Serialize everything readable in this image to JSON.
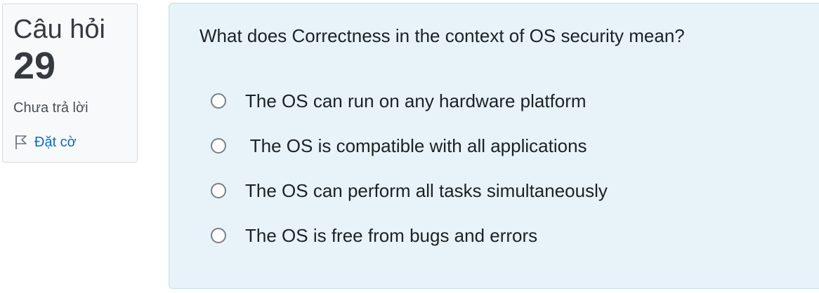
{
  "question_info": {
    "label": "Câu hỏi",
    "number": "29",
    "state": "Chưa trả lời",
    "flag_label": "Đặt cờ",
    "flag_icon": "flag-outline-icon"
  },
  "question": {
    "text": "What does Correctness in the context of OS security mean?",
    "answers": [
      {
        "label": "The OS can run on any hardware platform",
        "selected": false
      },
      {
        "label": " The OS is compatible with all applications",
        "selected": false
      },
      {
        "label": "The OS can perform all tasks simultaneously",
        "selected": false
      },
      {
        "label": "The OS is free from bugs and errors",
        "selected": false
      }
    ]
  },
  "colors": {
    "info_background": "#f8f9fa",
    "content_background": "#e7f3f8",
    "link": "#0f6cbf",
    "text": "#1d2125"
  }
}
